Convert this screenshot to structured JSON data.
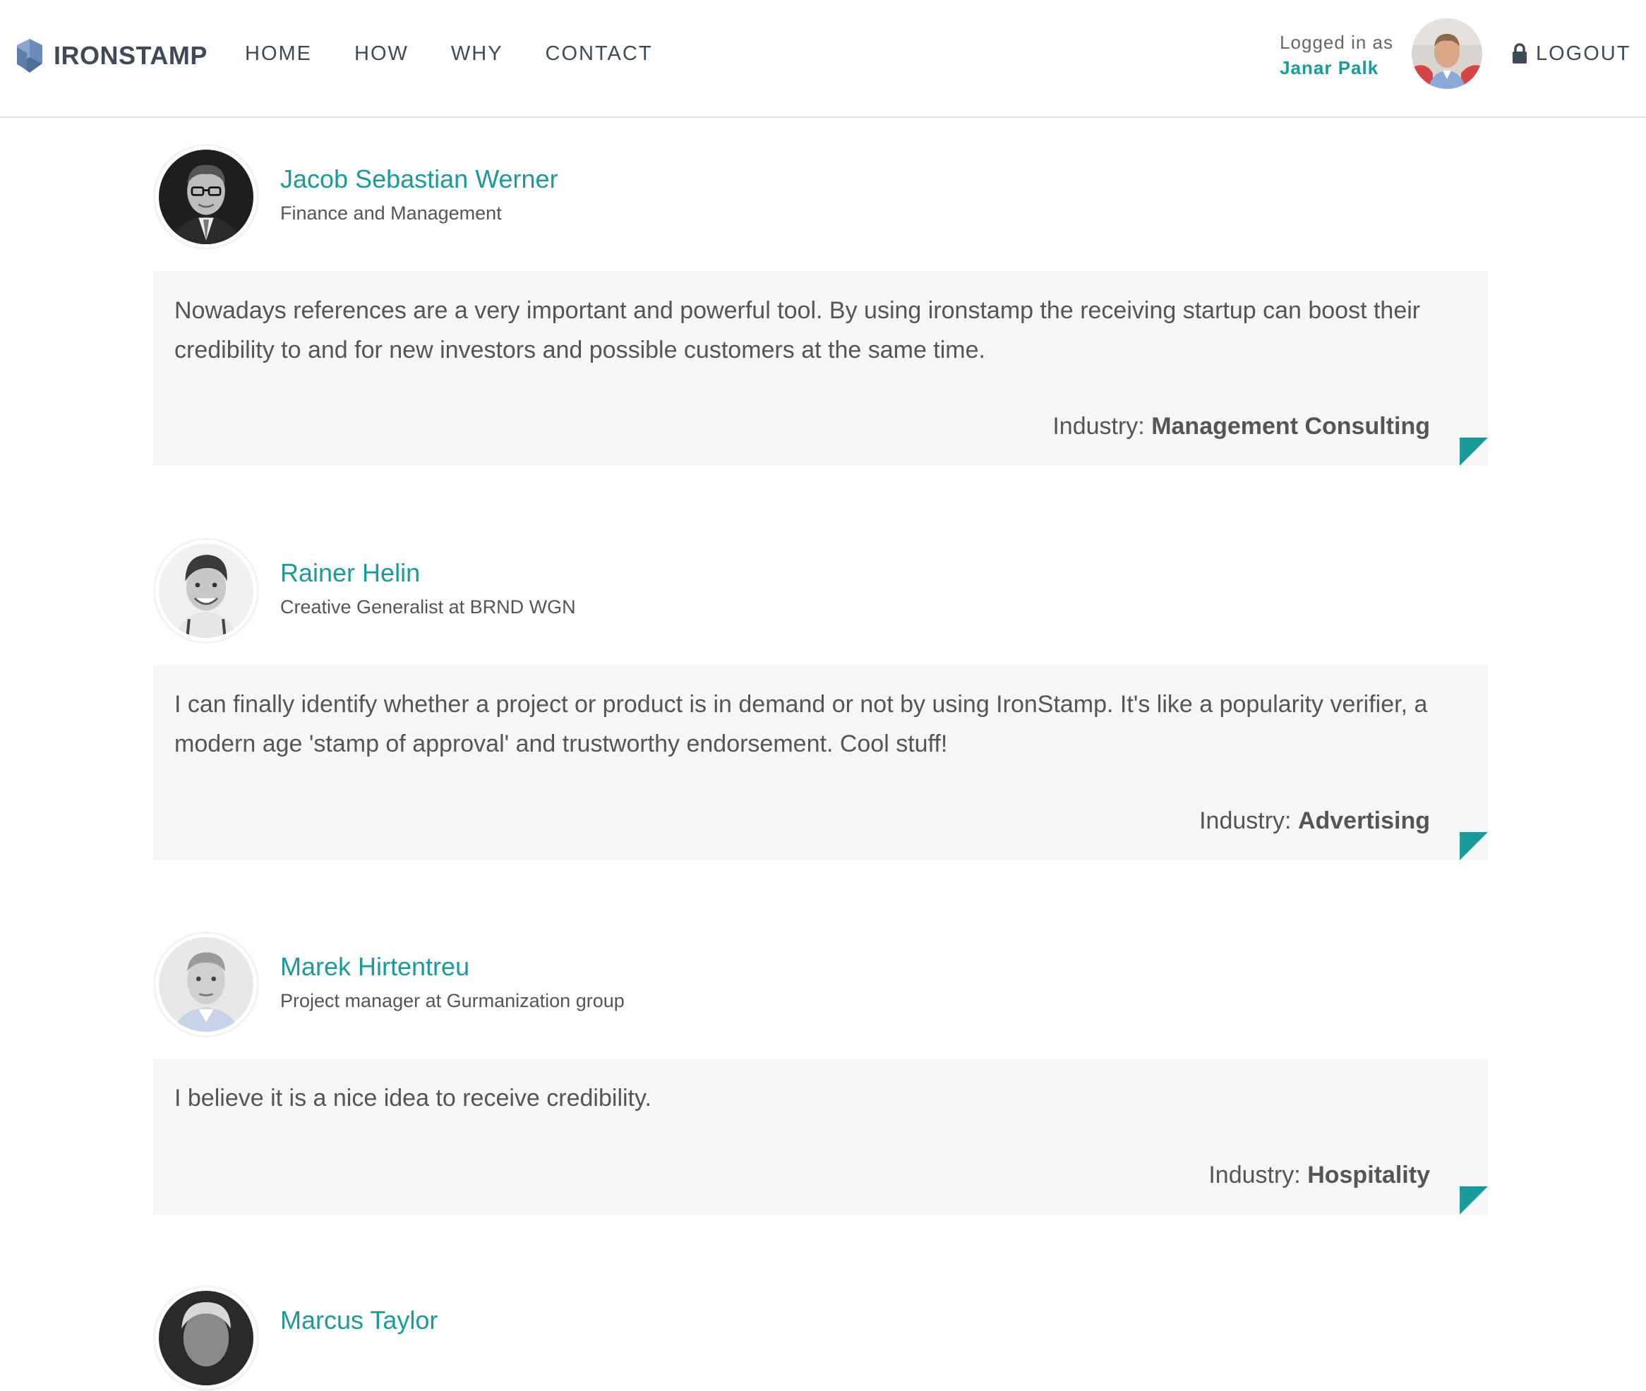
{
  "header": {
    "brand": "IRONSTAMP",
    "nav": [
      "HOME",
      "HOW",
      "WHY",
      "CONTACT"
    ],
    "logged_in_label": "Logged in as",
    "user_name": "Janar Palk",
    "logout_label": "LOGOUT"
  },
  "testimonials": [
    {
      "name": "Jacob Sebastian Werner",
      "title": "Finance and Management",
      "quote": "Nowadays references are a very important and powerful tool. By using ironstamp the receiving startup can boost their credibility to and for new investors and possible customers at the same time.",
      "industry_label": "Industry:",
      "industry": "Management Consulting"
    },
    {
      "name": "Rainer Helin",
      "title": "Creative Generalist at BRND WGN",
      "quote": "I can finally identify whether a project or product is in demand or not by using IronStamp. It's like a popularity verifier, a modern age 'stamp of approval' and trustworthy endorsement. Cool stuff!",
      "industry_label": "Industry:",
      "industry": "Advertising"
    },
    {
      "name": "Marek Hirtentreu",
      "title": "Project manager at Gurmanization group",
      "quote": "I believe it is a nice idea to receive credibility.",
      "industry_label": "Industry:",
      "industry": "Hospitality"
    },
    {
      "name": "Marcus Taylor"
    }
  ],
  "colors": {
    "accent": "#1a9a9a",
    "nav_text": "#3e4a57",
    "body_text": "#555555",
    "quote_bg": "#f6f6f6",
    "logo_icon": "#5b7fa8"
  },
  "icons": {
    "logo": "ironstamp-logo-icon",
    "lock": "lock-icon",
    "corner": "corner-fold-icon"
  }
}
